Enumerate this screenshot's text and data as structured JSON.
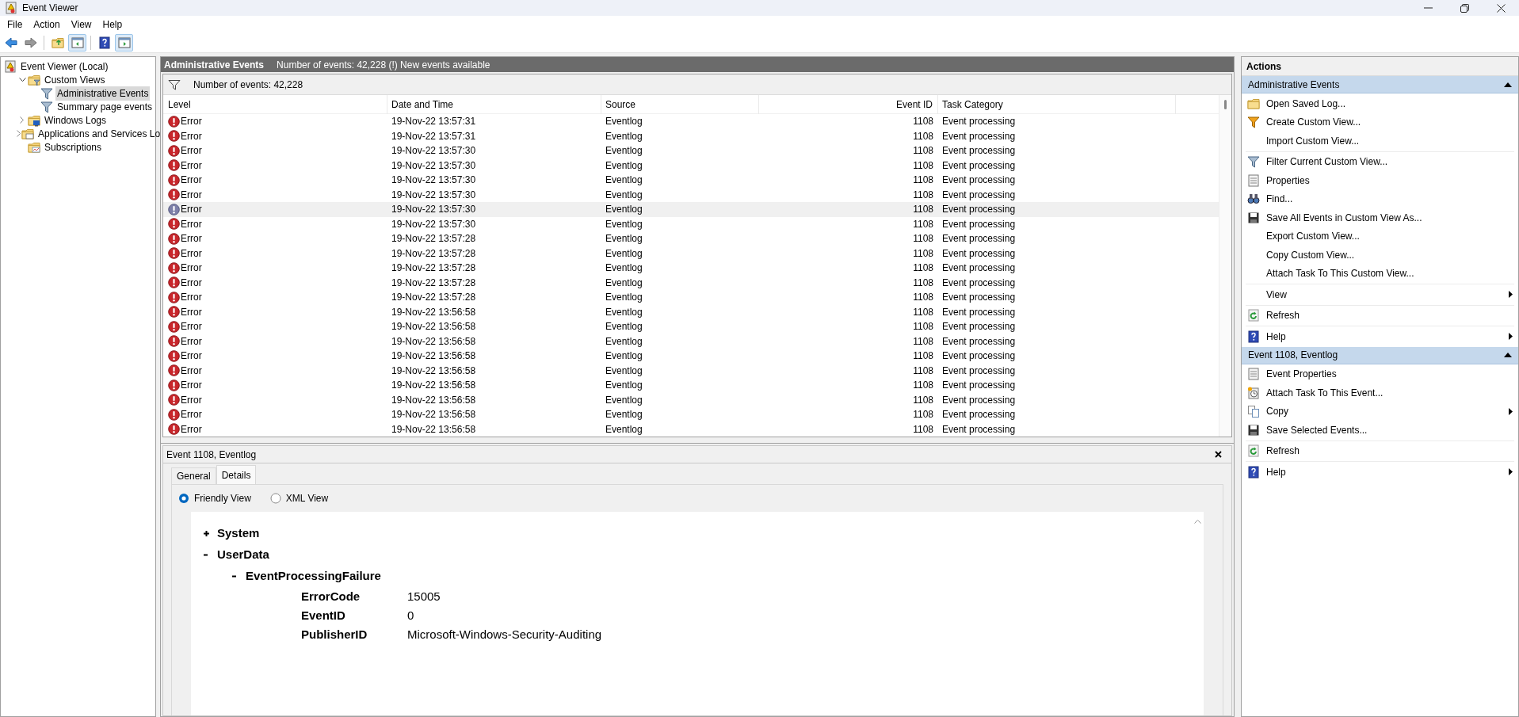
{
  "window": {
    "title": "Event Viewer"
  },
  "menu": [
    "File",
    "Action",
    "View",
    "Help"
  ],
  "toolbar": [
    {
      "pressed": false
    },
    {
      "pressed": false
    },
    {
      "pressed": false
    },
    {
      "pressed": true
    },
    {
      "pressed": false
    },
    {
      "pressed": true
    }
  ],
  "tree": [
    {
      "label": "Event Viewer (Local)",
      "kind": "root",
      "selected": false,
      "children": [
        {
          "label": "Custom Views",
          "kind": "folder-filter",
          "expanded": true,
          "selected": false,
          "children": [
            {
              "label": "Administrative Events",
              "kind": "filter",
              "selected": true
            },
            {
              "label": "Summary page events",
              "kind": "filter",
              "selected": false
            }
          ]
        },
        {
          "label": "Windows Logs",
          "kind": "folder-logs",
          "expanded": false,
          "selected": false
        },
        {
          "label": "Applications and Services Lo",
          "kind": "folder",
          "expanded": false,
          "selected": false
        },
        {
          "label": "Subscriptions",
          "kind": "folder-subs",
          "selected": false
        }
      ]
    }
  ],
  "events_header": {
    "title": "Administrative Events",
    "info": "Number of events: 42,228 (!) New events available"
  },
  "filter_bar": {
    "text": "Number of events: 42,228"
  },
  "table": {
    "columns": [
      "Level",
      "Date and Time",
      "Source",
      "Event ID",
      "Task Category"
    ],
    "rows": [
      {
        "level": "Error",
        "date": "19-Nov-22 13:57:31",
        "source": "Eventlog",
        "event_id": "1108",
        "category": "Event processing",
        "selected": false
      },
      {
        "level": "Error",
        "date": "19-Nov-22 13:57:31",
        "source": "Eventlog",
        "event_id": "1108",
        "category": "Event processing",
        "selected": false
      },
      {
        "level": "Error",
        "date": "19-Nov-22 13:57:30",
        "source": "Eventlog",
        "event_id": "1108",
        "category": "Event processing",
        "selected": false
      },
      {
        "level": "Error",
        "date": "19-Nov-22 13:57:30",
        "source": "Eventlog",
        "event_id": "1108",
        "category": "Event processing",
        "selected": false
      },
      {
        "level": "Error",
        "date": "19-Nov-22 13:57:30",
        "source": "Eventlog",
        "event_id": "1108",
        "category": "Event processing",
        "selected": false
      },
      {
        "level": "Error",
        "date": "19-Nov-22 13:57:30",
        "source": "Eventlog",
        "event_id": "1108",
        "category": "Event processing",
        "selected": false
      },
      {
        "level": "Error",
        "date": "19-Nov-22 13:57:30",
        "source": "Eventlog",
        "event_id": "1108",
        "category": "Event processing",
        "selected": true
      },
      {
        "level": "Error",
        "date": "19-Nov-22 13:57:30",
        "source": "Eventlog",
        "event_id": "1108",
        "category": "Event processing",
        "selected": false
      },
      {
        "level": "Error",
        "date": "19-Nov-22 13:57:28",
        "source": "Eventlog",
        "event_id": "1108",
        "category": "Event processing",
        "selected": false
      },
      {
        "level": "Error",
        "date": "19-Nov-22 13:57:28",
        "source": "Eventlog",
        "event_id": "1108",
        "category": "Event processing",
        "selected": false
      },
      {
        "level": "Error",
        "date": "19-Nov-22 13:57:28",
        "source": "Eventlog",
        "event_id": "1108",
        "category": "Event processing",
        "selected": false
      },
      {
        "level": "Error",
        "date": "19-Nov-22 13:57:28",
        "source": "Eventlog",
        "event_id": "1108",
        "category": "Event processing",
        "selected": false
      },
      {
        "level": "Error",
        "date": "19-Nov-22 13:57:28",
        "source": "Eventlog",
        "event_id": "1108",
        "category": "Event processing",
        "selected": false
      },
      {
        "level": "Error",
        "date": "19-Nov-22 13:56:58",
        "source": "Eventlog",
        "event_id": "1108",
        "category": "Event processing",
        "selected": false
      },
      {
        "level": "Error",
        "date": "19-Nov-22 13:56:58",
        "source": "Eventlog",
        "event_id": "1108",
        "category": "Event processing",
        "selected": false
      },
      {
        "level": "Error",
        "date": "19-Nov-22 13:56:58",
        "source": "Eventlog",
        "event_id": "1108",
        "category": "Event processing",
        "selected": false
      },
      {
        "level": "Error",
        "date": "19-Nov-22 13:56:58",
        "source": "Eventlog",
        "event_id": "1108",
        "category": "Event processing",
        "selected": false
      },
      {
        "level": "Error",
        "date": "19-Nov-22 13:56:58",
        "source": "Eventlog",
        "event_id": "1108",
        "category": "Event processing",
        "selected": false
      },
      {
        "level": "Error",
        "date": "19-Nov-22 13:56:58",
        "source": "Eventlog",
        "event_id": "1108",
        "category": "Event processing",
        "selected": false
      },
      {
        "level": "Error",
        "date": "19-Nov-22 13:56:58",
        "source": "Eventlog",
        "event_id": "1108",
        "category": "Event processing",
        "selected": false
      },
      {
        "level": "Error",
        "date": "19-Nov-22 13:56:58",
        "source": "Eventlog",
        "event_id": "1108",
        "category": "Event processing",
        "selected": false
      },
      {
        "level": "Error",
        "date": "19-Nov-22 13:56:58",
        "source": "Eventlog",
        "event_id": "1108",
        "category": "Event processing",
        "selected": false
      }
    ]
  },
  "detail": {
    "title": "Event 1108, Eventlog",
    "tabs": [
      {
        "label": "General",
        "selected": false
      },
      {
        "label": "Details",
        "selected": true
      }
    ],
    "views": [
      {
        "label": "Friendly View",
        "selected": true
      },
      {
        "label": "XML View",
        "selected": false
      }
    ],
    "tree": [
      {
        "label": "System",
        "expanded": false
      },
      {
        "label": "UserData",
        "expanded": true,
        "children": [
          {
            "label": "EventProcessingFailure",
            "expanded": true,
            "fields": [
              {
                "name": "ErrorCode",
                "value": "15005"
              },
              {
                "name": "EventID",
                "value": "0"
              },
              {
                "name": "PublisherID",
                "value": "Microsoft-Windows-Security-Auditing"
              }
            ]
          }
        ]
      }
    ]
  },
  "actions": {
    "title": "Actions",
    "sections": [
      {
        "title": "Administrative Events",
        "expanded": true,
        "groups": [
          [
            {
              "label": "Open Saved Log...",
              "submenu": false
            },
            {
              "label": "Create Custom View...",
              "submenu": false
            },
            {
              "label": "Import Custom View...",
              "submenu": false
            }
          ],
          [
            {
              "label": "Filter Current Custom View...",
              "submenu": false
            },
            {
              "label": "Properties",
              "submenu": false
            },
            {
              "label": "Find...",
              "submenu": false
            },
            {
              "label": "Save All Events in Custom View As...",
              "submenu": false
            },
            {
              "label": "Export Custom View...",
              "submenu": false
            },
            {
              "label": "Copy Custom View...",
              "submenu": false
            },
            {
              "label": "Attach Task To This Custom View...",
              "submenu": false
            }
          ],
          [
            {
              "label": "View",
              "submenu": true
            }
          ],
          [
            {
              "label": "Refresh",
              "submenu": false
            }
          ],
          [
            {
              "label": "Help",
              "submenu": true
            }
          ]
        ]
      },
      {
        "title": "Event 1108, Eventlog",
        "expanded": true,
        "groups": [
          [
            {
              "label": "Event Properties",
              "submenu": false
            },
            {
              "label": "Attach Task To This Event...",
              "submenu": false
            },
            {
              "label": "Copy",
              "submenu": true
            },
            {
              "label": "Save Selected Events...",
              "submenu": false
            }
          ],
          [
            {
              "label": "Refresh",
              "submenu": false
            }
          ],
          [
            {
              "label": "Help",
              "submenu": true
            }
          ]
        ]
      }
    ]
  }
}
